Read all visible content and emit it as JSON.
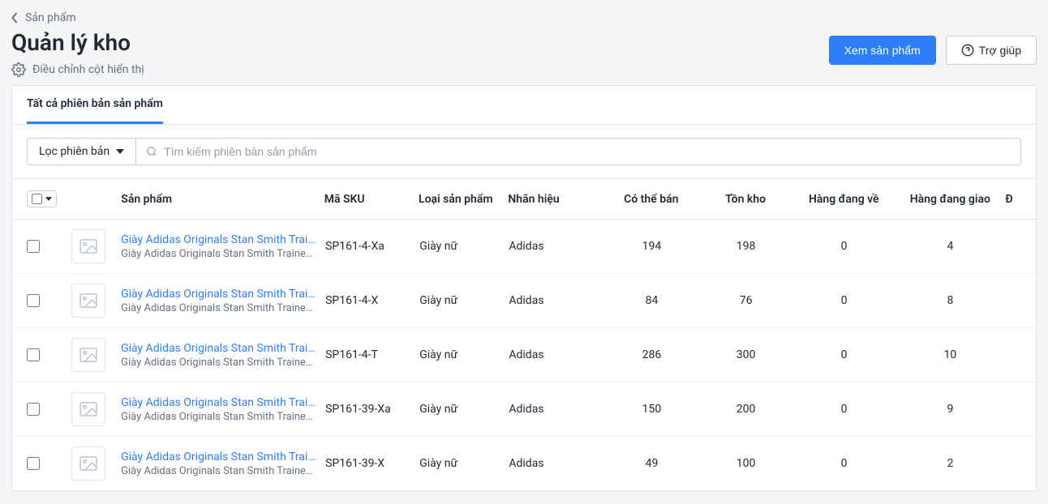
{
  "breadcrumb": {
    "label": "Sản phẩm"
  },
  "page": {
    "title": "Quản lý kho",
    "columns_config": "Điều chỉnh cột hiển thị"
  },
  "actions": {
    "view_products": "Xem sản phẩm",
    "help": "Trợ giúp"
  },
  "tabs": {
    "all": "Tất cả phiên bản sản phẩm"
  },
  "filter": {
    "label": "Lọc phiên bản",
    "search_placeholder": "Tìm kiếm phiên bản sản phẩm"
  },
  "columns": {
    "product": "Sản phẩm",
    "sku": "Mã SKU",
    "type": "Loại sản phẩm",
    "brand": "Nhãn hiệu",
    "available": "Có thể bán",
    "stock": "Tồn kho",
    "incoming": "Hàng đang về",
    "outgoing": "Hàng đang giao",
    "end": "Đ"
  },
  "rows": [
    {
      "name": "Giày Adidas Originals Stan Smith Trainer...",
      "sub": "Giày Adidas Originals Stan Smith Trainer...",
      "sku": "SP161-4-Xa",
      "type": "Giày nữ",
      "brand": "Adidas",
      "available": 194,
      "stock": 198,
      "incoming": 0,
      "outgoing": 4
    },
    {
      "name": "Giày Adidas Originals Stan Smith Trainer...",
      "sub": "Giày Adidas Originals Stan Smith Trainer...",
      "sku": "SP161-4-X",
      "type": "Giày nữ",
      "brand": "Adidas",
      "available": 84,
      "stock": 76,
      "incoming": 0,
      "outgoing": 8
    },
    {
      "name": "Giày Adidas Originals Stan Smith Trainer...",
      "sub": "Giày Adidas Originals Stan Smith Trainer...",
      "sku": "SP161-4-T",
      "type": "Giày nữ",
      "brand": "Adidas",
      "available": 286,
      "stock": 300,
      "incoming": 0,
      "outgoing": 10
    },
    {
      "name": "Giày Adidas Originals Stan Smith Trainer...",
      "sub": "Giày Adidas Originals Stan Smith Trainer...",
      "sku": "SP161-39-Xa",
      "type": "Giày nữ",
      "brand": "Adidas",
      "available": 150,
      "stock": 200,
      "incoming": 0,
      "outgoing": 9
    },
    {
      "name": "Giày Adidas Originals Stan Smith Trainer...",
      "sub": "Giày Adidas Originals Stan Smith Trainer...",
      "sku": "SP161-39-X",
      "type": "Giày nữ",
      "brand": "Adidas",
      "available": 49,
      "stock": 100,
      "incoming": 0,
      "outgoing": 2
    }
  ]
}
